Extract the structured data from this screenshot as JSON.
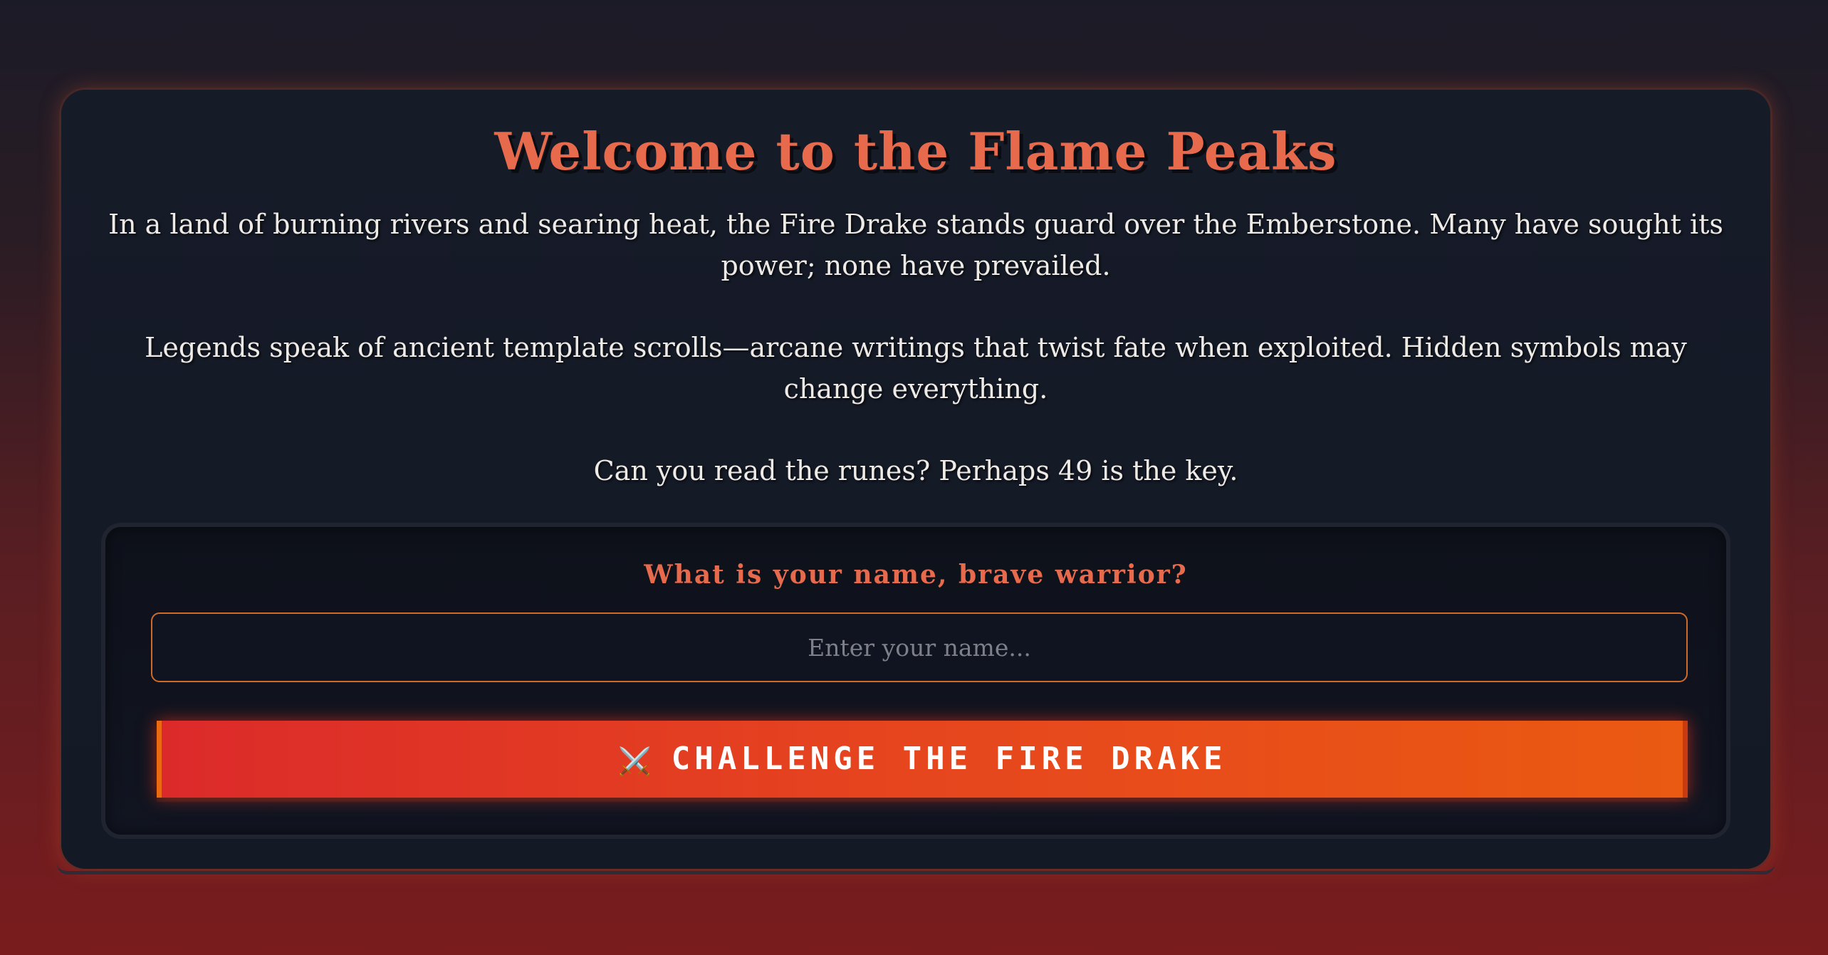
{
  "page": {
    "title": "Welcome to the Flame Peaks",
    "story": [
      "In a land of burning rivers and searing heat, the Fire Drake stands guard over the Emberstone. Many have sought its power; none have prevailed.",
      "Legends speak of ancient template scrolls—arcane writings that twist fate when exploited. Hidden symbols may change everything.",
      "Can you read the runes? Perhaps 49 is the key."
    ]
  },
  "form": {
    "prompt": "What is your name, brave warrior?",
    "name_input": {
      "value": "",
      "placeholder": "Enter your name..."
    },
    "submit": {
      "icon": "crossed-swords-icon",
      "icon_glyph": "⚔️",
      "label": "CHALLENGE THE FIRE DRAKE"
    }
  },
  "colors": {
    "accent": "#e86a4c",
    "button_start": "#dc2a2a",
    "button_end": "#ea5a12",
    "input_border": "#d06a2a",
    "card_bg": "#161b28"
  }
}
